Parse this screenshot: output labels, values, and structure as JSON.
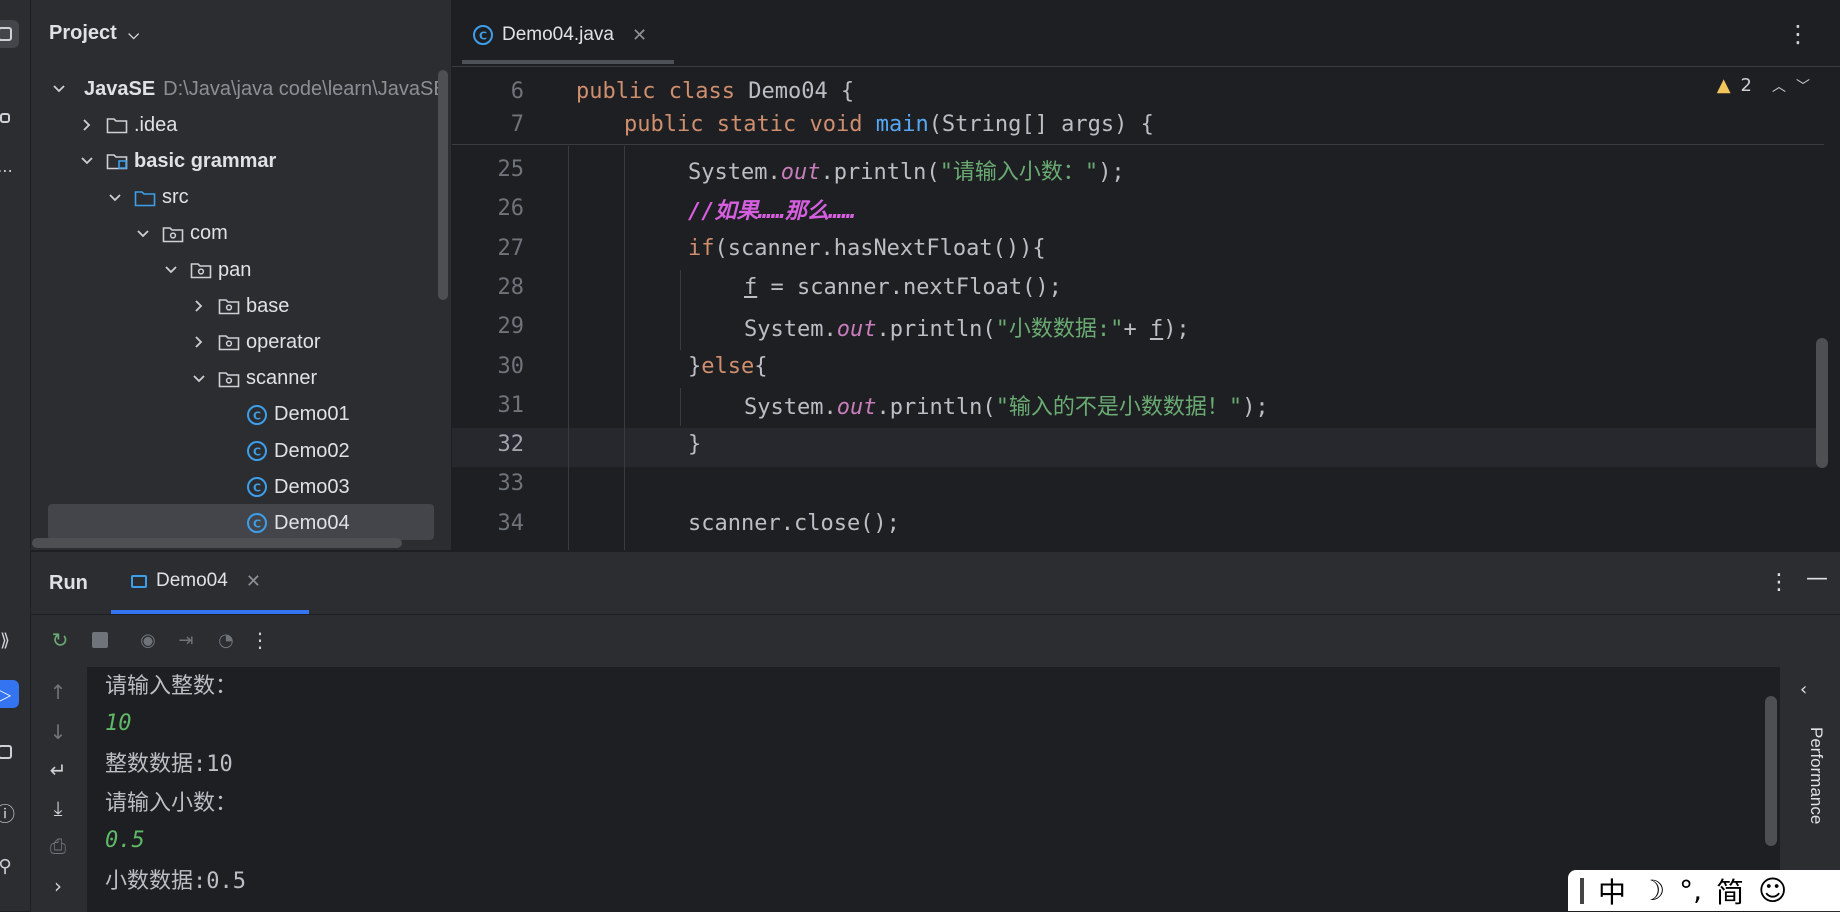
{
  "project": {
    "title": "Project",
    "tree": [
      {
        "label": "JavaSE",
        "path": "D:\\Java\\java code\\learn\\JavaSE",
        "level": 0,
        "expanded": true,
        "kind": "module"
      },
      {
        "label": ".idea",
        "level": 1,
        "expanded": false,
        "kind": "folder"
      },
      {
        "label": "basic grammar",
        "level": 1,
        "expanded": true,
        "kind": "module"
      },
      {
        "label": "src",
        "level": 2,
        "expanded": true,
        "kind": "src"
      },
      {
        "label": "com",
        "level": 3,
        "expanded": true,
        "kind": "package"
      },
      {
        "label": "pan",
        "level": 4,
        "expanded": true,
        "kind": "package"
      },
      {
        "label": "base",
        "level": 5,
        "expanded": false,
        "kind": "package"
      },
      {
        "label": "operator",
        "level": 5,
        "expanded": false,
        "kind": "package"
      },
      {
        "label": "scanner",
        "level": 5,
        "expanded": true,
        "kind": "package"
      },
      {
        "label": "Demo01",
        "level": 6,
        "kind": "class"
      },
      {
        "label": "Demo02",
        "level": 6,
        "kind": "class"
      },
      {
        "label": "Demo03",
        "level": 6,
        "kind": "class"
      },
      {
        "label": "Demo04",
        "level": 6,
        "kind": "class",
        "selected": true
      }
    ]
  },
  "editor": {
    "tab": "Demo04.java",
    "warnings": "2",
    "sticky": [
      {
        "num": "6",
        "code": "public class Demo04 {"
      },
      {
        "num": "7",
        "code": "public static void main(String[] args) {"
      }
    ],
    "lines": [
      {
        "num": "25",
        "text": "System.out.println(\"请输入小数：\");"
      },
      {
        "num": "26",
        "text": "//如果……那么……"
      },
      {
        "num": "27",
        "text": "if(scanner.hasNextFloat()){"
      },
      {
        "num": "28",
        "text": "f = scanner.nextFloat();"
      },
      {
        "num": "29",
        "text": "System.out.println(\"小数数据:\"+ f);"
      },
      {
        "num": "30",
        "text": "}else{"
      },
      {
        "num": "31",
        "text": "System.out.println(\"输入的不是小数数据！\");"
      },
      {
        "num": "32",
        "text": "}"
      },
      {
        "num": "33",
        "text": ""
      },
      {
        "num": "34",
        "text": "scanner.close();"
      }
    ]
  },
  "run": {
    "title": "Run",
    "tab": "Demo04",
    "console": [
      {
        "text": "请输入整数：",
        "input": false
      },
      {
        "text": "10",
        "input": true
      },
      {
        "text": "整数数据:10",
        "input": false
      },
      {
        "text": "请输入小数：",
        "input": false
      },
      {
        "text": "0.5",
        "input": true
      },
      {
        "text": "小数数据:0.5",
        "input": false
      }
    ],
    "side_panel": "Performance"
  },
  "ime": {
    "items": [
      "中",
      "☽",
      "°,",
      "简",
      "☺"
    ]
  }
}
